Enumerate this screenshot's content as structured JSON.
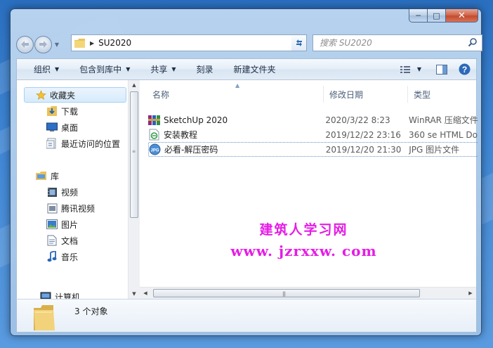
{
  "window": {
    "caption_min": "─",
    "caption_max": "□",
    "caption_close": "✕"
  },
  "navigation": {
    "back_icon": "back-arrow-icon",
    "forward_icon": "forward-arrow-icon",
    "path_separator": "▶",
    "path": "SU2020",
    "search_placeholder": "搜索 SU2020"
  },
  "toolbar": {
    "organize": "组织",
    "include_in_library": "包含到库中",
    "share": "共享",
    "burn": "刻录",
    "new_folder": "新建文件夹"
  },
  "sidebar": {
    "items": [
      {
        "label": "收藏夹",
        "icon": "star-icon"
      },
      {
        "label": "下载",
        "icon": "download-folder-icon"
      },
      {
        "label": "桌面",
        "icon": "desktop-icon"
      },
      {
        "label": "最近访问的位置",
        "icon": "recent-places-icon"
      },
      {
        "label": "库",
        "icon": "library-icon"
      },
      {
        "label": "视频",
        "icon": "video-library-icon"
      },
      {
        "label": "腾讯视频",
        "icon": "tencent-video-icon"
      },
      {
        "label": "图片",
        "icon": "pictures-library-icon"
      },
      {
        "label": "文档",
        "icon": "documents-library-icon"
      },
      {
        "label": "音乐",
        "icon": "music-library-icon"
      },
      {
        "label": "计算机",
        "icon": "computer-icon"
      }
    ]
  },
  "columns": {
    "name": "名称",
    "date_modified": "修改日期",
    "type": "类型"
  },
  "files": [
    {
      "name": "SketchUp 2020",
      "date": "2020/3/22 8:23",
      "type": "WinRAR 压缩文件",
      "icon": "winrar-archive-icon"
    },
    {
      "name": "安装教程",
      "date": "2019/12/22 23:16",
      "type": "360 se HTML Do",
      "icon": "html-document-icon"
    },
    {
      "name": "必看-解压密码",
      "date": "2019/12/20 21:30",
      "type": "JPG 图片文件",
      "icon": "jpg-image-icon"
    }
  ],
  "watermark": {
    "site_name": "建筑人学习网",
    "url": "www. jzrxxw. com"
  },
  "status": {
    "item_count": "3 个对象"
  },
  "colors": {
    "watermark": "#e61ce6",
    "selection": "#d7ebfc"
  }
}
